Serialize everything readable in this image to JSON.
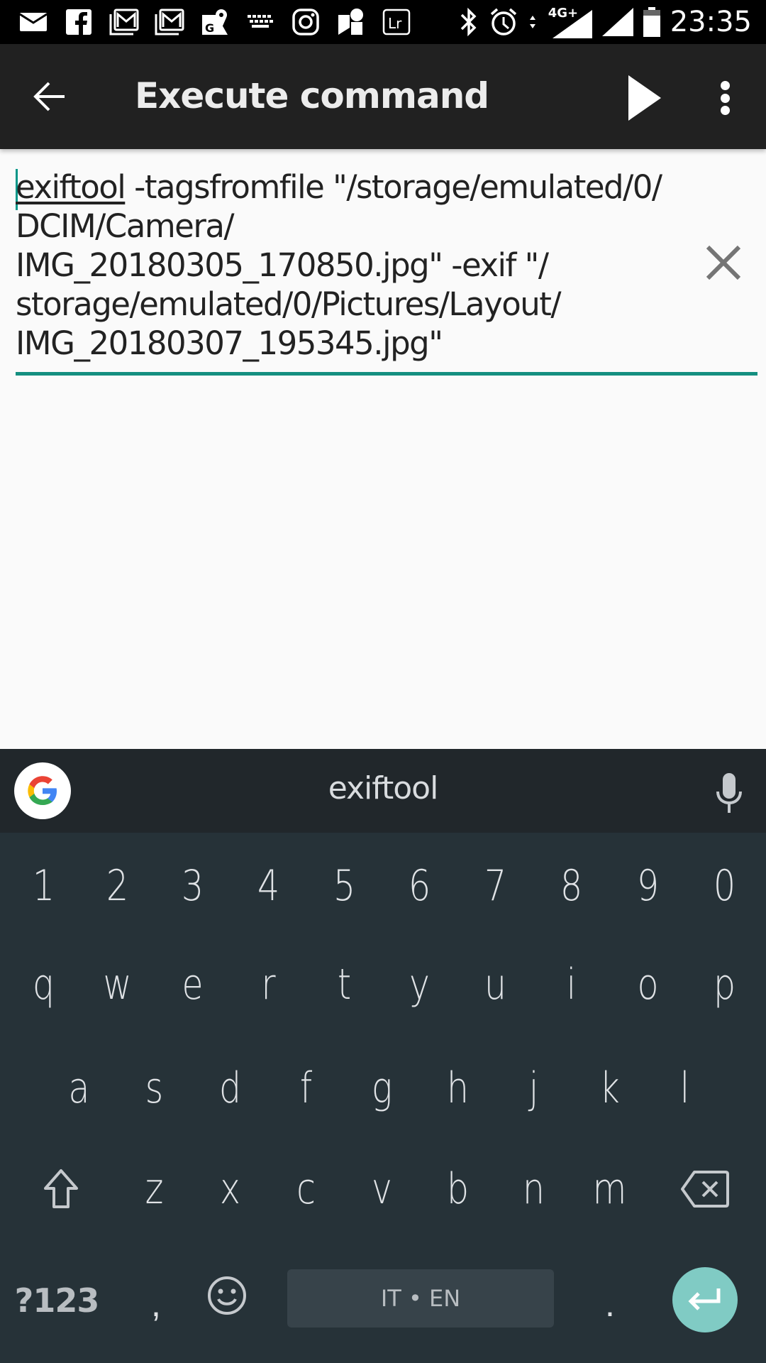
{
  "status_bar": {
    "notification_icons": [
      "mail-icon",
      "facebook-icon",
      "gmail-icon",
      "gmail-icon",
      "google-maps-icon",
      "keyboard-icon",
      "instagram-icon",
      "google-photos-icon",
      "lightroom-icon"
    ],
    "system_icons": [
      "bluetooth-icon",
      "alarm-icon",
      "data-activity-icon",
      "signal-4g-plus-icon",
      "signal-icon",
      "battery-icon"
    ],
    "network_label": "4G+",
    "time": "23:35"
  },
  "app_bar": {
    "title": "Execute command",
    "back_icon": "arrow-back-icon",
    "run_icon": "play-icon",
    "menu_icon": "more-vert-icon"
  },
  "command": {
    "first_word": "exiftool",
    "rest": " -tagsfromfile \"/storage/emulated/0/\nDCIM/Camera/\nIMG_20180305_170850.jpg\" -exif \"/\nstorage/emulated/0/Pictures/Layout/\nIMG_20180307_195345.jpg\"",
    "accent_color": "#148f80",
    "clear_icon": "close-icon"
  },
  "keyboard": {
    "suggestion": "exiftool",
    "number_row": [
      "1",
      "2",
      "3",
      "4",
      "5",
      "6",
      "7",
      "8",
      "9",
      "0"
    ],
    "row1": [
      "q",
      "w",
      "e",
      "r",
      "t",
      "y",
      "u",
      "i",
      "o",
      "p"
    ],
    "row2": [
      "a",
      "s",
      "d",
      "f",
      "g",
      "h",
      "j",
      "k",
      "l"
    ],
    "row3": [
      "z",
      "x",
      "c",
      "v",
      "b",
      "n",
      "m"
    ],
    "symbols_label": "?123",
    "comma": ",",
    "space_label": "IT • EN",
    "period": ".",
    "enter_color": "#80cbc4",
    "background_color": "#263238"
  }
}
